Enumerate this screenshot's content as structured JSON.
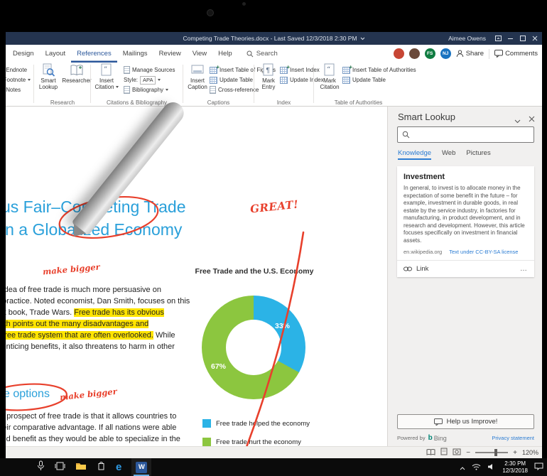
{
  "colors": {
    "accent_blue": "#2b579a",
    "titlebar_navy": "#24344f",
    "heading_blue": "#2aa0da",
    "annotation_red": "#e8402c",
    "highlight_yellow": "#ffe400",
    "chart_blue": "#2bb3e6",
    "chart_green": "#8cc63f",
    "link_blue": "#2b7cd3"
  },
  "titlebar": {
    "title": "Competing Trade Theories.docx  -  Last Saved 12/3/2018 2:30 PM",
    "user": "Aimee Owens"
  },
  "ribbon": {
    "tabs": [
      "Design",
      "Layout",
      "References",
      "Mailings",
      "Review",
      "View",
      "Help"
    ],
    "active_tab": "References",
    "search": "Search",
    "share": "Share",
    "comments": "Comments",
    "avatars": [
      {
        "initials": "",
        "color": "#c74634"
      },
      {
        "initials": "",
        "color": "#6b4a3a"
      },
      {
        "initials": "FS",
        "color": "#107c41"
      },
      {
        "initials": "NJ",
        "color": "#1a73c0"
      }
    ],
    "groups": [
      {
        "label": "",
        "items": [
          {
            "t": "Insert Endnote"
          },
          {
            "t": "Next Footnote"
          },
          {
            "t": "Show Notes"
          }
        ]
      },
      {
        "label": "Research",
        "big": [
          {
            "l1": "Smart",
            "l2": "Lookup"
          },
          {
            "l1": "Researcher",
            "l2": ""
          }
        ],
        "items": []
      },
      {
        "label": "Citations & Bibliography",
        "big": [
          {
            "l1": "Insert",
            "l2": "Citation"
          }
        ],
        "items": [
          {
            "t": "Manage Sources"
          },
          {
            "t": "Style:",
            "value": "APA"
          },
          {
            "t": "Bibliography"
          }
        ]
      },
      {
        "label": "Captions",
        "big": [
          {
            "l1": "Insert",
            "l2": "Caption"
          }
        ],
        "items": [
          {
            "t": "Insert Table of Figures"
          },
          {
            "t": "Update Table"
          },
          {
            "t": "Cross-reference"
          }
        ]
      },
      {
        "label": "Index",
        "big": [
          {
            "l1": "Mark",
            "l2": "Entry"
          }
        ],
        "items": [
          {
            "t": "Insert Index"
          },
          {
            "t": "Update Index"
          }
        ]
      },
      {
        "label": "Table of Authorities",
        "big": [
          {
            "l1": "Mark",
            "l2": "Citation"
          }
        ],
        "items": [
          {
            "t": "Insert Table of Authorities"
          },
          {
            "t": "Update Table"
          }
        ]
      }
    ]
  },
  "doc": {
    "h1a": "us Fair–Competing Trade",
    "h1b": "in a Globalized Economy",
    "great": "GREAT!",
    "mb1": "make bigger",
    "mb2": "make bigger",
    "p1": {
      "l1": "e idea of free trade is much more persuasive on",
      "l2": "n practice. Noted economist, Dan Smith, focuses on this",
      "l3a": "est book, Trade Wars. ",
      "l3hl": "Free trade has its obvious",
      "l4hl": "mith points out the many disadvantages and",
      "l5hl": "a free trade system that are often overlooked.",
      "l5b": " While",
      "l6": "s enticing benefits, it also threatens to harm in other"
    },
    "h2": "e options",
    "p2": {
      "l1": "ng prospect of free trade is that it allows countries to",
      "l2": "their comparative advantage. If all nations were able",
      "l3": "ould benefit as they would be able to specialize in the"
    }
  },
  "chart_data": {
    "type": "pie",
    "donut": true,
    "title": "Free Trade and the U.S. Economy",
    "labels": [
      "Free trade helped the economy",
      "Free trade hurt the economy"
    ],
    "values": [
      33,
      67
    ],
    "colors": [
      "#2bb3e6",
      "#8cc63f"
    ],
    "data_labels": [
      "33%",
      "67%"
    ],
    "legend_position": "bottom"
  },
  "pane": {
    "title": "Smart Lookup",
    "tabs": [
      "Knowledge",
      "Web",
      "Pictures"
    ],
    "active_tab": "Knowledge",
    "search_value": "",
    "card": {
      "title": "Investment",
      "body": "In general, to invest is to allocate money in the expectation of some benefit in the future – for example, investment in durable goods, in real estate by the service industry, in factories for manufacturing, in product development, and in research and development. However, this article focuses specifically on investment in financial assets.",
      "source": "en.wikipedia.org",
      "license": "Text under CC-BY-SA license",
      "link_label": "Link",
      "more": "…"
    },
    "help_button": "Help us Improve!",
    "powered_by": "Powered by",
    "bing": "Bing",
    "privacy": "Privacy statement"
  },
  "statusbar": {
    "zoom": "120%"
  },
  "taskbar": {
    "time": "2:30 PM",
    "date": "12/3/2018"
  }
}
